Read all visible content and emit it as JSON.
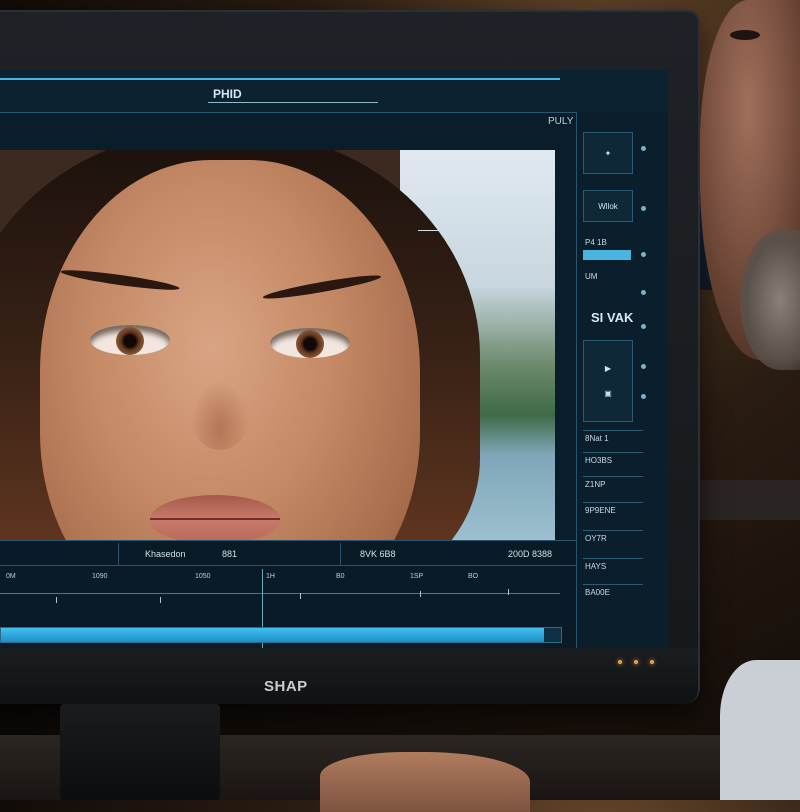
{
  "app": {
    "title": "PHID",
    "panel_title": "PULY SHIABE"
  },
  "sidebar": {
    "items": [
      {
        "label": "✦"
      },
      {
        "label": "Wllok"
      },
      {
        "label": "P4 1B"
      },
      {
        "label": "UM"
      },
      {
        "label": "SI VAK"
      },
      {
        "label": "▶"
      },
      {
        "label": "▣"
      }
    ],
    "rows": [
      "8Nat 1",
      "HO3BS",
      "Z1NP",
      "9P9ENE",
      "OY7R",
      "HAYS",
      "BA00E"
    ]
  },
  "timeline": {
    "labels": [
      "Khasedon",
      "881",
      "8VK 6B8",
      "200D 8388"
    ],
    "ticks": [
      "0M",
      "1090",
      "1050",
      "1H",
      "B0",
      "1SP",
      "BO"
    ],
    "progress": 0.97
  },
  "monitor": {
    "brand": "SHAP"
  },
  "colors": {
    "accent": "#4bb3df",
    "screen_bg": "#0a1d2b",
    "panel_border": "#29556f",
    "led": "#e8a04a"
  }
}
